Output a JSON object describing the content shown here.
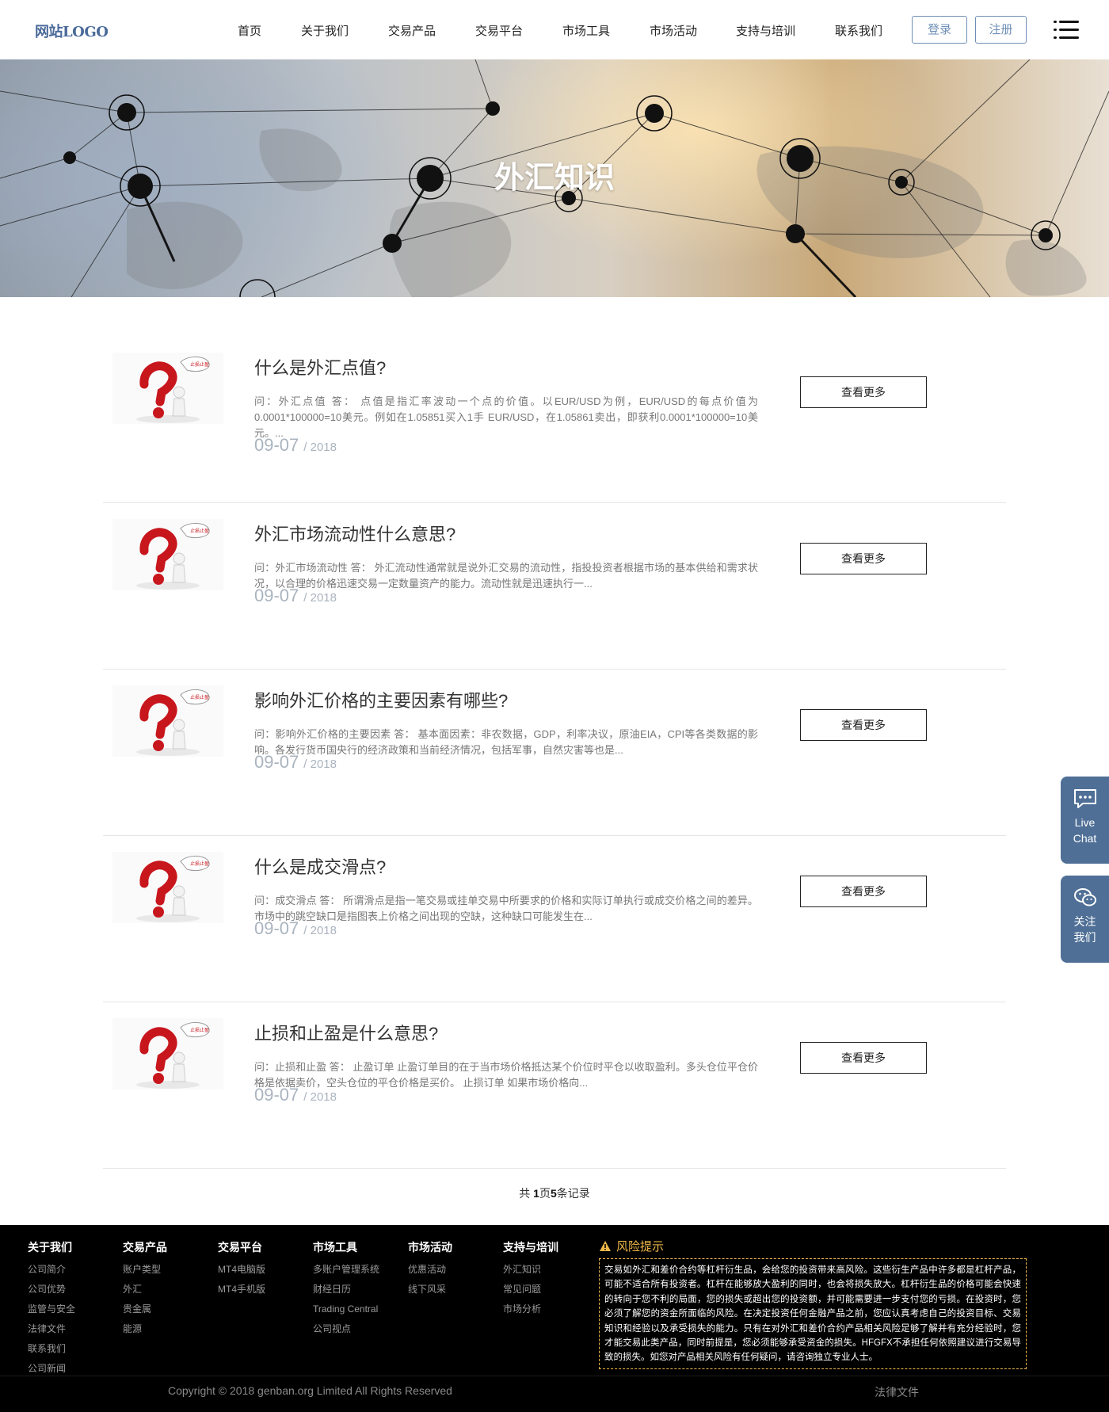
{
  "header": {
    "logo": "网站LOGO",
    "nav": [
      "首页",
      "关于我们",
      "交易产品",
      "交易平台",
      "市场工具",
      "市场活动",
      "支持与培训",
      "联系我们"
    ],
    "login": "登录",
    "register": "注册"
  },
  "banner": {
    "title": "外汇知识"
  },
  "articles": [
    {
      "title": "什么是外汇点值?",
      "excerpt": "问：外汇点值 答： 点值是指汇率波动一个点的价值。以EUR/USD为例，EUR/USD的每点价值为0.0001*100000=10美元。例如在1.05851买入1手 EUR/USD，在1.05861卖出，即获利0.0001*100000=10美元。...",
      "date": "09-07",
      "year": "/ 2018",
      "more": "查看更多"
    },
    {
      "title": "外汇市场流动性什么意思?",
      "excerpt": "问：外汇市场流动性 答： 外汇流动性通常就是说外汇交易的流动性，指投投资者根据市场的基本供给和需求状况，以合理的价格迅速交易一定数量资产的能力。流动性就是迅速执行一...",
      "date": "09-07",
      "year": "/ 2018",
      "more": "查看更多"
    },
    {
      "title": "影响外汇价格的主要因素有哪些?",
      "excerpt": "问：影响外汇价格的主要因素 答： 基本面因素：非农数据，GDP，利率决议，原油EIA，CPI等各类数据的影响。各发行货币国央行的经济政策和当前经济情况，包括军事，自然灾害等也是...",
      "date": "09-07",
      "year": "/ 2018",
      "more": "查看更多"
    },
    {
      "title": "什么是成交滑点?",
      "excerpt": "问：成交滑点 答： 所谓滑点是指一笔交易或挂单交易中所要求的价格和实际订单执行或成交价格之间的差异。市场中的跳空缺口是指图表上价格之间出现的空缺，这种缺口可能发生在...",
      "date": "09-07",
      "year": "/ 2018",
      "more": "查看更多"
    },
    {
      "title": "止损和止盈是什么意思?",
      "excerpt": "问：止损和止盈 答： 止盈订单 止盈订单目的在于当市场价格抵达某个价位时平仓以收取盈利。多头仓位平仓价格是依据卖价，空头仓位的平仓价格是买价。 止损订单 如果市场价格向...",
      "date": "09-07",
      "year": "/ 2018",
      "more": "查看更多"
    }
  ],
  "pager": {
    "prefix": "共 ",
    "pages": "1",
    "mid": "页",
    "records": "5",
    "suffix": "条记录"
  },
  "float": {
    "chat_line1": "Live",
    "chat_line2": "Chat",
    "follow_line1": "关注",
    "follow_line2": "我们"
  },
  "footer": {
    "columns": [
      {
        "head": "关于我们",
        "links": [
          "公司简介",
          "公司优势",
          "监管与安全",
          "法律文件",
          "联系我们",
          "公司新闻"
        ]
      },
      {
        "head": "交易产品",
        "links": [
          "账户类型",
          "外汇",
          "贵金属",
          "能源"
        ]
      },
      {
        "head": "交易平台",
        "links": [
          "MT4电脑版",
          "MT4手机版"
        ]
      },
      {
        "head": "市场工具",
        "links": [
          "多账户管理系统",
          "财经日历",
          "Trading Central",
          "公司视点"
        ]
      },
      {
        "head": "市场活动",
        "links": [
          "优惠活动",
          "线下风采"
        ]
      },
      {
        "head": "支持与培训",
        "links": [
          "外汇知识",
          "常见问题",
          "市场分析"
        ]
      }
    ],
    "risk_title": "风险提示",
    "risk_text": "交易如外汇和差价合约等杠杆衍生品，会给您的投资带来高风险。这些衍生产品中许多都是杠杆产品，可能不适合所有投资者。杠杆在能够放大盈利的同时，也会将损失放大。杠杆衍生品的价格可能会快速的转向于您不利的局面，您的损失或超出您的投资额，并可能需要进一步支付您的亏损。在投资时，您必须了解您的资金所面临的风险。在决定投资任何金融产品之前，您应认真考虑自己的投资目标、交易知识和经验以及承受损失的能力。只有在对外汇和差价合约产品相关风险足够了解并有充分经验时，您才能交易此类产品，同时前提是，您必须能够承受资金的损失。HFGFX不承担任何依照建议进行交易导致的损失。如您对产品相关风险有任何疑问，请咨询独立专业人士。",
    "copyright": "Copyright © 2018 genban.org Limited All Rights Reserved",
    "legal": "法律文件"
  },
  "colors": {
    "accent": "#6e8fb5",
    "float_bg": "#4f6f96",
    "risk": "#f0b94a",
    "footer_bg": "#000000"
  },
  "icons": [
    "menu-icon",
    "chat-icon",
    "wechat-icon",
    "warning-icon",
    "question-mark-figure-icon"
  ]
}
